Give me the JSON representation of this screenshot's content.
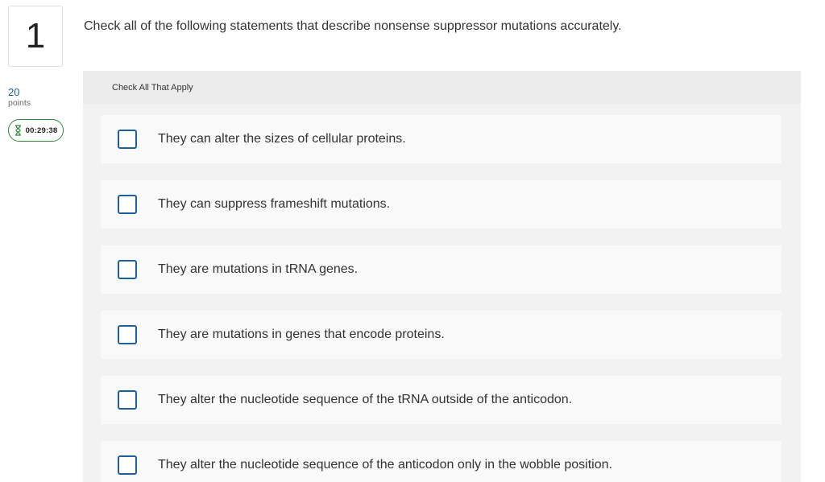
{
  "question": {
    "number": "1",
    "points_value": "20",
    "points_label": "points",
    "timer": "00:29:38",
    "prompt": "Check all of the following statements that describe nonsense suppressor mutations accurately."
  },
  "answers": {
    "instruction": "Check All That Apply",
    "options": [
      {
        "label": "They can alter the sizes of cellular proteins.",
        "checked": false
      },
      {
        "label": "They can suppress frameshift mutations.",
        "checked": false
      },
      {
        "label": "They are mutations in tRNA genes.",
        "checked": false
      },
      {
        "label": "They are mutations in genes that encode proteins.",
        "checked": false
      },
      {
        "label": "They alter the nucleotide sequence of the tRNA outside of the anticodon.",
        "checked": false
      },
      {
        "label": "They alter the nucleotide sequence of the anticodon only in the wobble position.",
        "checked": false
      }
    ]
  },
  "icons": {
    "timer_icon": "hourglass-icon",
    "checkbox_icon": "checkbox-unchecked-icon"
  },
  "colors": {
    "accent": "#1d5f9b",
    "timer_border": "#2e8b3a",
    "panel_bg": "#f2f2f2",
    "option_bg": "#f9f9f9"
  }
}
